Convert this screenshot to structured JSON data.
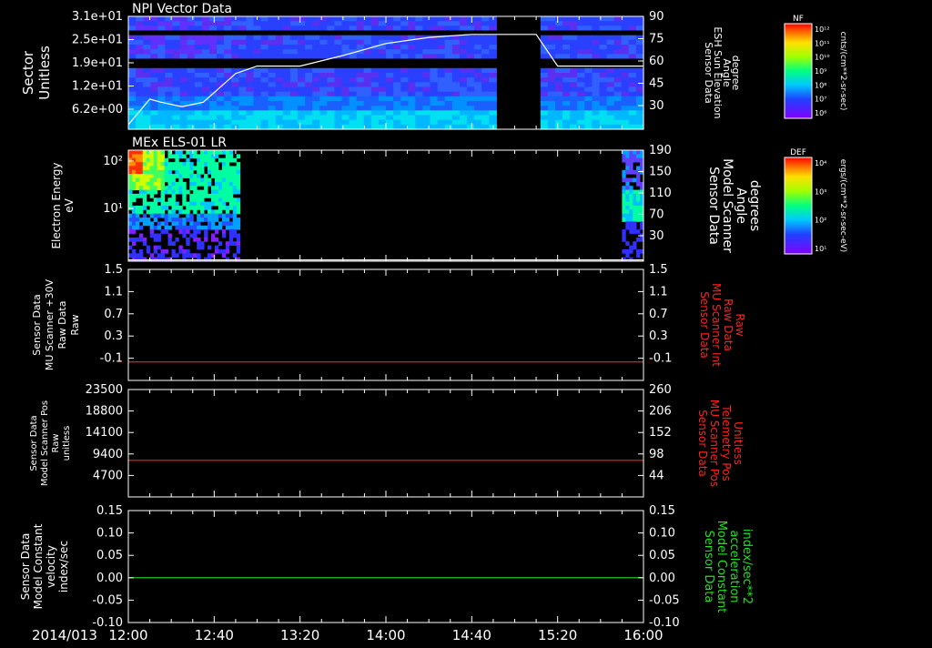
{
  "date_label": "2014/013",
  "x_ticks": [
    "12:00",
    "12:40",
    "13:20",
    "14:00",
    "14:40",
    "15:20",
    "16:00"
  ],
  "chart_data": [
    {
      "type": "heatmap",
      "title": "NPI Vector Data",
      "ylabel": [
        "Sector",
        "Unitless"
      ],
      "y_ticks": [
        "3.1e+01",
        "2.5e+01",
        "1.9e+01",
        "1.2e+01",
        "6.2e+00"
      ],
      "y2label": [
        "Sensor Data",
        "ESH Sun Elevation",
        "Angle",
        "degree"
      ],
      "y2_ticks": [
        "90",
        "75",
        "60",
        "45",
        "30"
      ],
      "y2_range": [
        15,
        90
      ],
      "overlay_line": {
        "color": "#ffffff",
        "x": [
          "12:00",
          "12:10",
          "12:15",
          "12:25",
          "12:35",
          "12:50",
          "13:00",
          "13:20",
          "13:40",
          "14:00",
          "14:20",
          "14:40",
          "14:56",
          "15:10",
          "15:20",
          "16:00"
        ],
        "y": [
          18,
          35,
          33,
          30,
          33,
          52,
          57,
          57,
          64,
          72,
          76,
          78,
          78,
          78,
          57,
          57
        ]
      },
      "data_gap": [
        "14:53",
        "15:10"
      ],
      "colorbar": {
        "label": "NF",
        "unit": "cnts/(cm**2-sr-sec)",
        "ticks": [
          "10¹²",
          "10¹¹",
          "10¹⁰",
          "10⁹",
          "10⁸",
          "10⁷",
          "10⁶"
        ]
      }
    },
    {
      "type": "heatmap",
      "title": "MEx ELS-01 LR",
      "ylabel": [
        "Electron Energy",
        "eV"
      ],
      "y_ticks": [
        "10²",
        "10¹"
      ],
      "y2label": [
        "Sensor Data",
        "Model Scanner",
        "Angle",
        "degrees"
      ],
      "y2_ticks": [
        "190",
        "150",
        "110",
        "70",
        "30"
      ],
      "y2_range": [
        10,
        190
      ],
      "overlay_line": {
        "color": "#ffffff",
        "x": [
          "12:00",
          "16:00"
        ],
        "y": [
          12,
          12
        ]
      },
      "data_segments": [
        [
          "12:00",
          "12:52"
        ],
        [
          "15:50",
          "16:00"
        ]
      ],
      "colorbar": {
        "label": "DEF",
        "unit": "ergs/(cm**2-sr-sec-eV)",
        "ticks": [
          "10⁴",
          "10³",
          "10²",
          "10¹"
        ]
      }
    },
    {
      "type": "line",
      "ylabel": [
        "Sensor Data",
        "MU Scanner +30V",
        "Raw Data",
        "Raw"
      ],
      "y_ticks": [
        "1.5",
        "1.1",
        "0.7",
        "0.3",
        "-0.1"
      ],
      "ylim": [
        -0.3,
        1.5
      ],
      "y2label": [
        "Sensor Data",
        "MU Scanner Int",
        "Raw Data",
        "Raw"
      ],
      "y2_ticks": [
        "1.5",
        "1.1",
        "0.7",
        "0.3",
        "-0.1"
      ],
      "series": [
        {
          "color": "#ff2020",
          "x": [
            "12:00",
            "16:00"
          ],
          "y": [
            0.0,
            0.0
          ]
        }
      ]
    },
    {
      "type": "line",
      "ylabel": [
        "Sensor Data",
        "Model Scanner Pos",
        "Raw",
        "unitless"
      ],
      "y_ticks": [
        "23500",
        "18800",
        "14100",
        "9400",
        "4700"
      ],
      "ylim": [
        0,
        23500
      ],
      "y2label": [
        "Sensor Data",
        "MU Scanner Pos",
        "Telemetry Pos",
        "Unitless"
      ],
      "y2_ticks": [
        "260",
        "206",
        "152",
        "98",
        "44"
      ],
      "series": [
        {
          "color": "#ff2020",
          "x": [
            "12:00",
            "16:00"
          ],
          "y": [
            8000,
            8000
          ]
        }
      ]
    },
    {
      "type": "line",
      "ylabel": [
        "Sensor Data",
        "Model Constant",
        "velocity",
        "index/sec"
      ],
      "y_ticks": [
        "0.15",
        "0.10",
        "0.05",
        "0.00",
        "-0.05",
        "-0.10"
      ],
      "ylim": [
        -0.1,
        0.15
      ],
      "y2label": [
        "Sensor Data",
        "Model Constant",
        "acceleration",
        "index/sec**2"
      ],
      "y2_ticks": [
        "0.15",
        "0.10",
        "0.05",
        "0.00",
        "-0.05",
        "-0.10"
      ],
      "series": [
        {
          "color": "#20e020",
          "x": [
            "12:00",
            "16:00"
          ],
          "y": [
            0.0,
            0.0
          ]
        }
      ]
    }
  ],
  "colors": {
    "white": "#ffffff",
    "red_label": "#ff2020",
    "green_label": "#20e020"
  }
}
